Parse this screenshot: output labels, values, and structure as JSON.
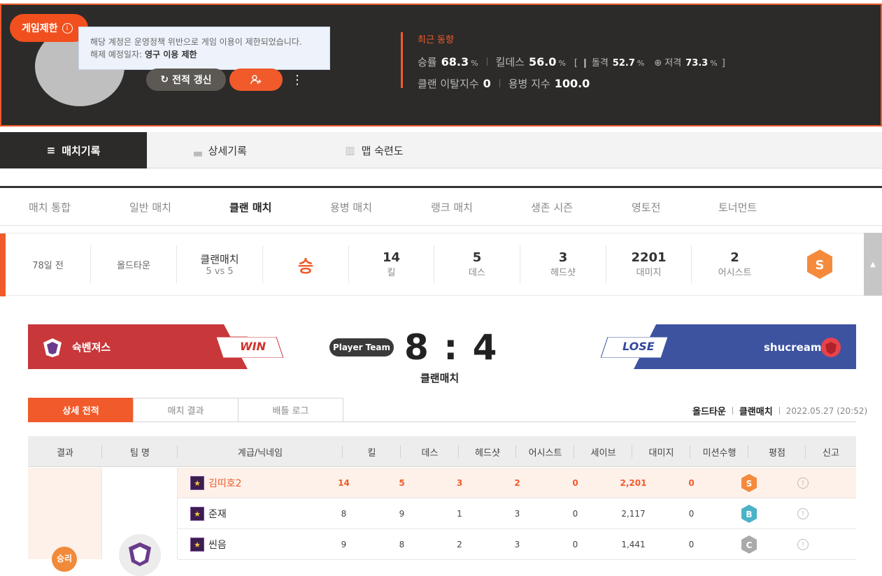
{
  "header": {
    "ban_badge": "게임제한",
    "tooltip_line1": "해당 계정은 운영정책 위반으로 게임 이용이 제한되었습니다.",
    "tooltip_line2_label": "해제 예정일자:",
    "tooltip_line2_value": "영구 이용 제한",
    "refresh_label": "전적 갱신",
    "trend_title": "최근 동향",
    "win_rate_label": "승률",
    "win_rate": "68.3",
    "kd_label": "킬데스",
    "kd": "56.0",
    "assault_label": "돌격",
    "assault": "52.7",
    "sniper_label": "저격",
    "sniper": "73.3",
    "pct": "%",
    "clan_leave_label": "클랜 이탈지수",
    "clan_leave": "0",
    "merc_label": "용병 지수",
    "merc": "100.0"
  },
  "main_tabs": [
    "매치기록",
    "상세기록",
    "맵 숙련도"
  ],
  "sub_tabs": [
    "매치 통합",
    "일반 매치",
    "클랜 매치",
    "용병 매치",
    "랭크 매치",
    "생존 시즌",
    "영토전",
    "토너먼트"
  ],
  "summary": {
    "ago": "78일 전",
    "map": "올드타운",
    "mode": "클랜매치",
    "mode_sub": "5 vs 5",
    "result": "승",
    "kills": "14",
    "kills_label": "킬",
    "deaths": "5",
    "deaths_label": "데스",
    "headshots": "3",
    "headshots_label": "헤드샷",
    "damage": "2201",
    "damage_label": "대미지",
    "assists": "2",
    "assists_label": "어시스트",
    "grade": "S"
  },
  "match": {
    "team_left": "슉벤져스",
    "team_left_result": "WIN",
    "team_right": "shucream",
    "team_right_result": "LOSE",
    "player_team": "Player Team",
    "score": "8 : 4",
    "mode": "클랜매치"
  },
  "detail_tabs": [
    "상세 전적",
    "매치 결과",
    "배틀 로그"
  ],
  "meta": {
    "map": "올드타운",
    "mode": "클랜매치",
    "datetime": "2022.05.27 (20:52)"
  },
  "table": {
    "headers": [
      "결과",
      "팀 명",
      "계급/닉네임",
      "킬",
      "데스",
      "헤드샷",
      "어시스트",
      "세이브",
      "대미지",
      "미션수행",
      "평점",
      "신고"
    ],
    "rows": [
      {
        "nick": "김띠호2",
        "kill": "14",
        "death": "5",
        "hs": "3",
        "assist": "2",
        "save": "0",
        "dmg": "2,201",
        "mission": "0",
        "grade": "S",
        "grade_color": "#f58a3c"
      },
      {
        "nick": "준재",
        "kill": "8",
        "death": "9",
        "hs": "1",
        "assist": "3",
        "save": "0",
        "dmg": "2,117",
        "mission": "0",
        "grade": "B",
        "grade_color": "#4bb3c7"
      },
      {
        "nick": "씬음",
        "kill": "9",
        "death": "8",
        "hs": "2",
        "assist": "3",
        "save": "0",
        "dmg": "1,441",
        "mission": "0",
        "grade": "C",
        "grade_color": "#aaaaaa"
      }
    ],
    "result_partial": "승리"
  },
  "colors": {
    "accent": "#f15a2b",
    "header_bg": "#2c2b29",
    "win_red": "#c8373a",
    "lose_blue": "#3d53a0"
  }
}
